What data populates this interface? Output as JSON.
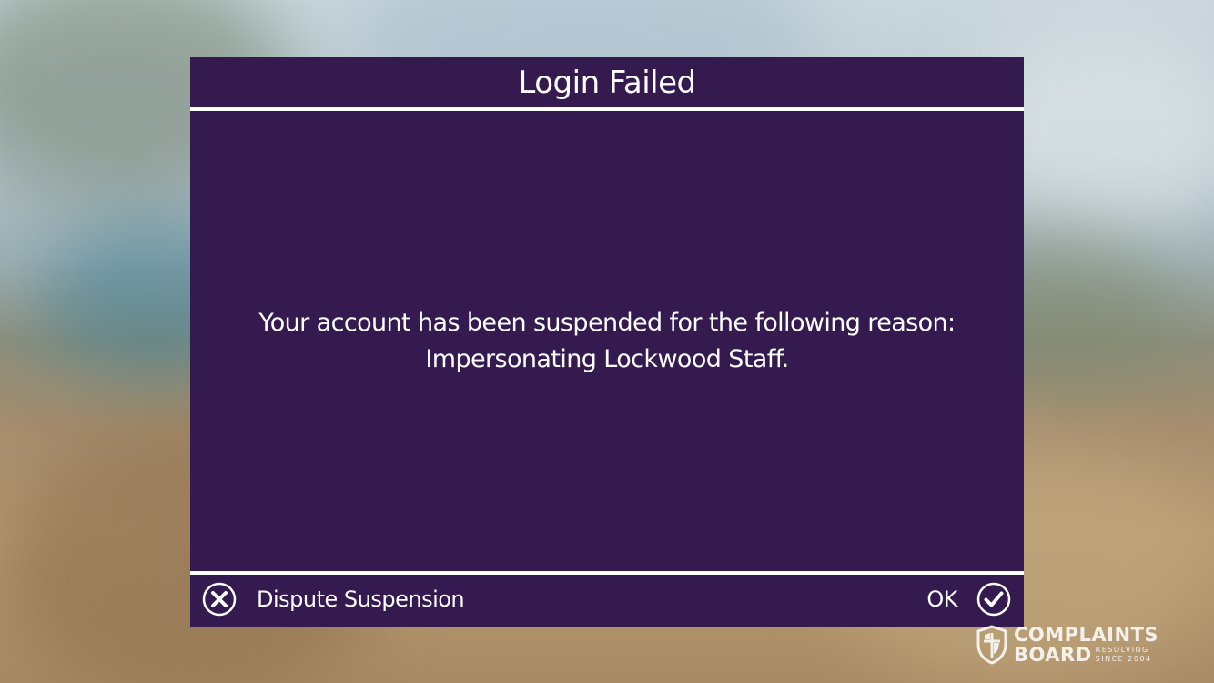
{
  "dialog": {
    "title": "Login Failed",
    "message_line1": "Your account has been suspended for the following reason:",
    "message_line2": "Impersonating Lockwood Staff."
  },
  "footer": {
    "dispute_label": "Dispute Suspension",
    "dispute_icon": "close-circle-icon",
    "ok_label": "OK",
    "ok_icon": "check-circle-icon"
  },
  "watermark": {
    "line1": "COMPLAINTS",
    "line2": "BOARD",
    "tag_line1": "RESOLVING",
    "tag_line2": "SINCE 2004"
  },
  "colors": {
    "dialog_background": "#351a50",
    "text": "#ffffff"
  }
}
